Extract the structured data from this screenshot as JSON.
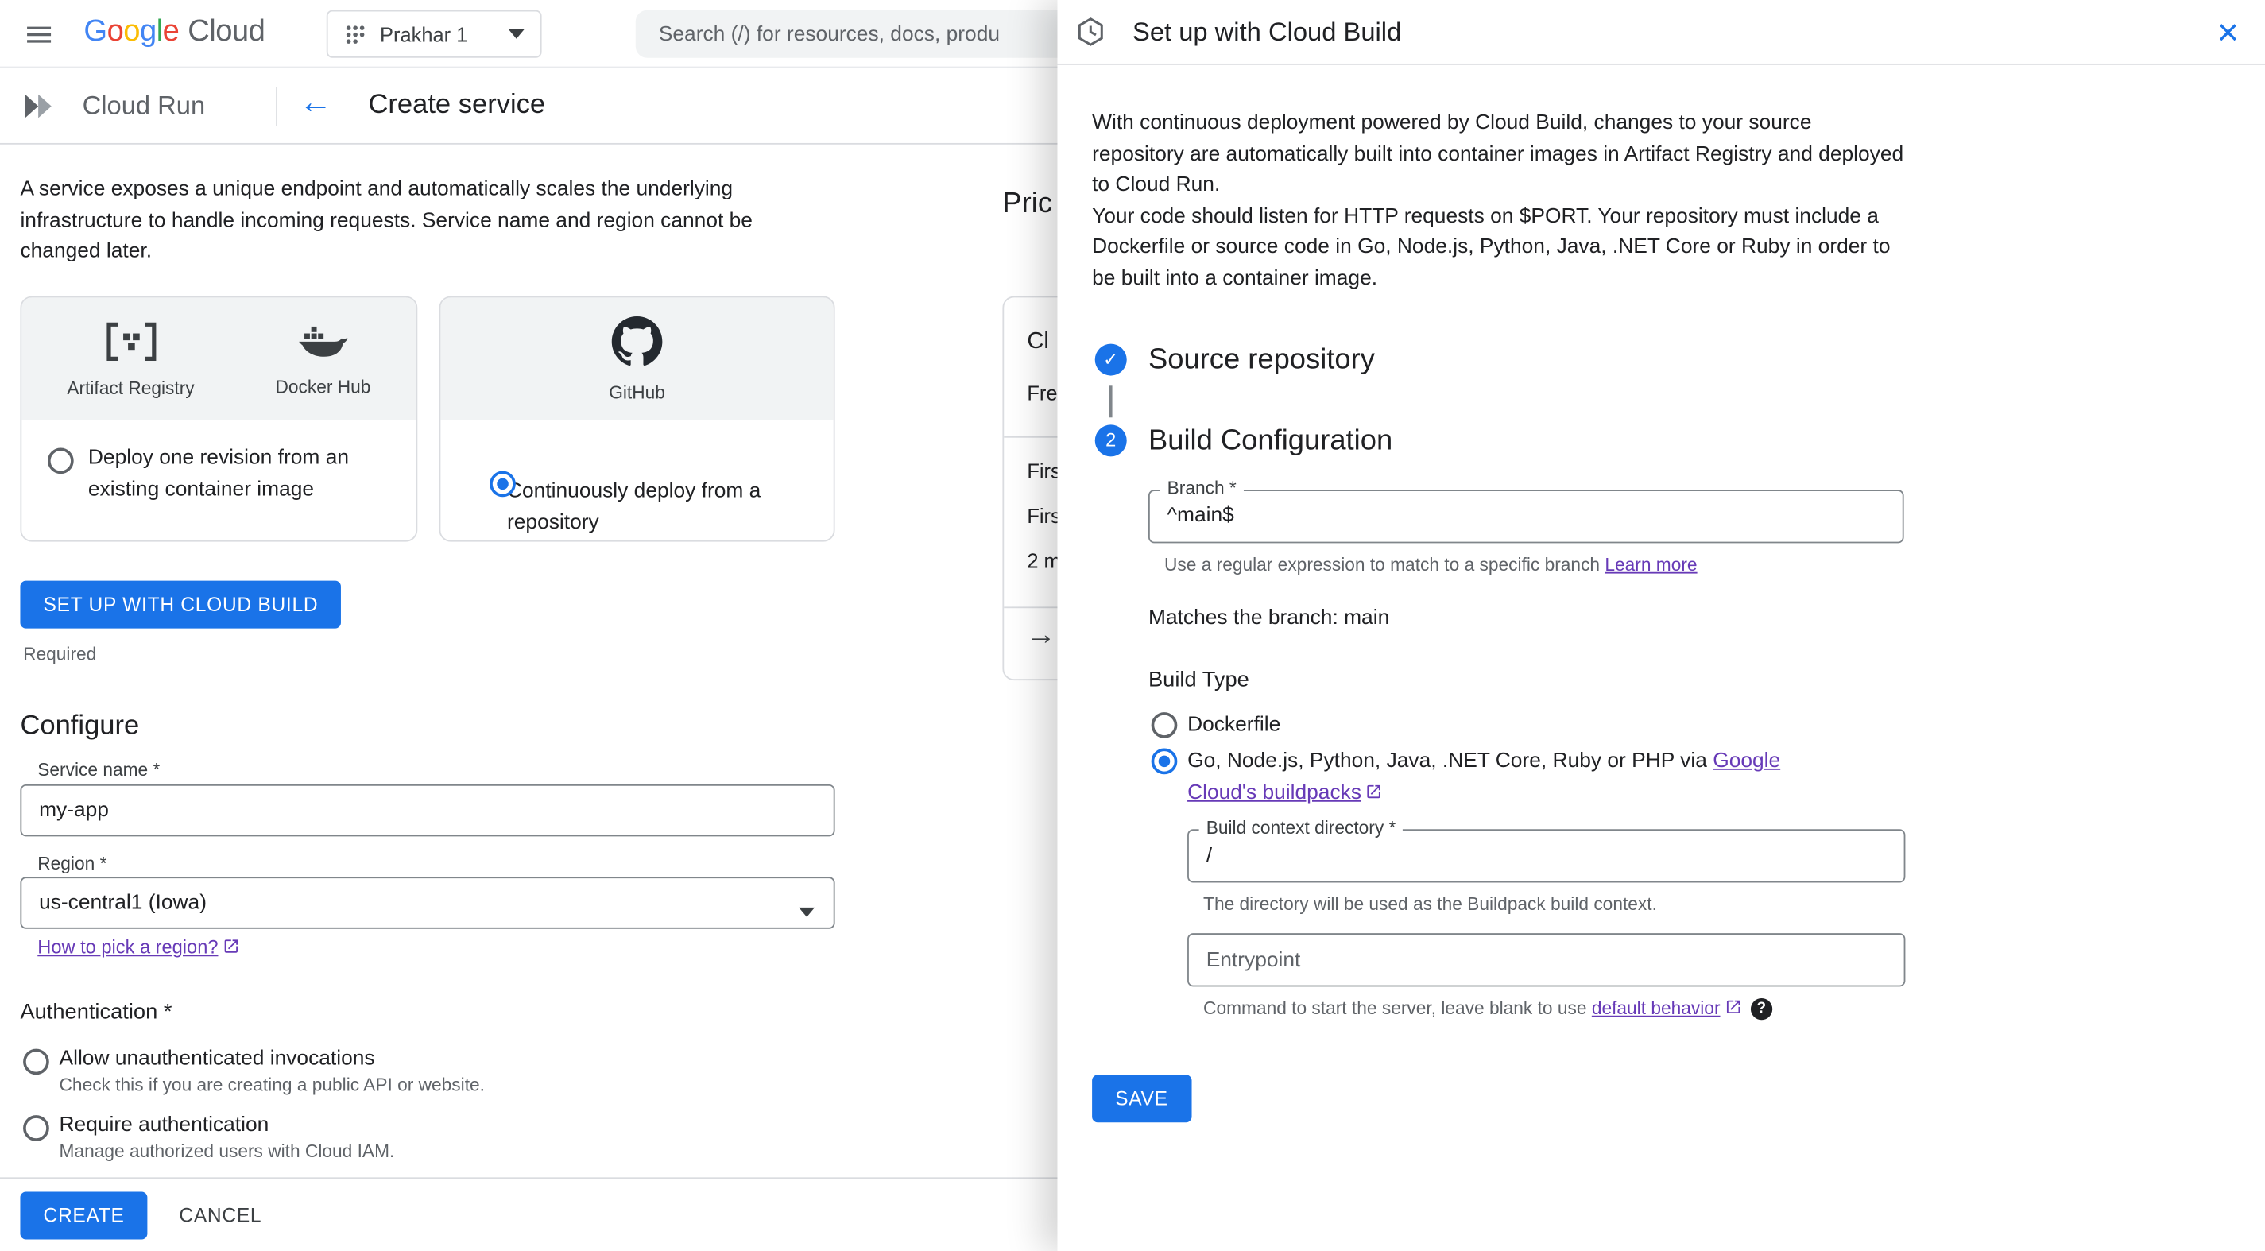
{
  "colors": {
    "accent_blue": "#1a73e8",
    "link_purple": "#673ab7",
    "text_primary": "#202124",
    "text_secondary": "#5f6368",
    "border": "#dadce0",
    "field_border": "#80868b",
    "surface_gray": "#f1f3f4"
  },
  "icons": {
    "back_arrow": "←",
    "forward_arrow": "→",
    "check": "✓",
    "close": "×",
    "help": "?"
  },
  "topbar": {
    "logo_letters": [
      {
        "ch": "G",
        "color": "#4285F4"
      },
      {
        "ch": "o",
        "color": "#EA4335"
      },
      {
        "ch": "o",
        "color": "#FBBC04"
      },
      {
        "ch": "g",
        "color": "#4285F4"
      },
      {
        "ch": "l",
        "color": "#34A853"
      },
      {
        "ch": "e",
        "color": "#EA4335"
      }
    ],
    "logo_cloud": "Cloud",
    "project_selector": "Prakhar 1",
    "search_placeholder": "Search (/) for resources, docs, produ"
  },
  "page_header": {
    "product": "Cloud Run",
    "title": "Create service"
  },
  "create_service": {
    "description": "A service exposes a unique endpoint and automatically scales the underlying infrastructure to handle incoming requests. Service name and region cannot be changed later.",
    "cards": [
      {
        "icons": [
          {
            "name": "artifact-registry",
            "label": "Artifact Registry"
          },
          {
            "name": "docker-hub",
            "label": "Docker Hub"
          }
        ],
        "option": "Deploy one revision from an existing container image",
        "selected": false
      },
      {
        "icons": [
          {
            "name": "github",
            "label": "GitHub"
          }
        ],
        "option": "Continuously deploy from a repository",
        "selected": true
      }
    ],
    "setup_button": "SET UP WITH CLOUD BUILD",
    "required_label": "Required",
    "configure_heading": "Configure",
    "service_name": {
      "label": "Service name *",
      "value": "my-app"
    },
    "region": {
      "label": "Region *",
      "value": "us-central1 (Iowa)",
      "link": "How to pick a region?"
    },
    "authentication": {
      "heading": "Authentication *",
      "options": [
        {
          "label": "Allow unauthenticated invocations",
          "description": "Check this if you are creating a public API or website."
        },
        {
          "label": "Require authentication",
          "description": "Manage authorized users with Cloud IAM."
        }
      ]
    },
    "footer": {
      "create": "CREATE",
      "cancel": "CANCEL"
    }
  },
  "pricing": {
    "heading_fragment": "Pric",
    "row1_fragment": "Cl",
    "row2_fragment": "Fre",
    "row3_fragment": "Firs",
    "row4_fragment": "Firs",
    "row5_fragment": "2 m"
  },
  "panel": {
    "title": "Set up with Cloud Build",
    "intro_1": "With continuous deployment powered by Cloud Build, changes to your source repository are automatically built into container images in Artifact Registry and deployed to Cloud Run.",
    "intro_2": "Your code should listen for HTTP requests on $PORT. Your repository must include a Dockerfile or source code in Go, Node.js, Python, Java, .NET Core or Ruby in order to be built into a container image.",
    "step1_title": "Source repository",
    "step2_number": "2",
    "step2_title": "Build Configuration",
    "branch": {
      "label": "Branch *",
      "value": "^main$",
      "helper": "Use a regular expression to match to a specific branch ",
      "helper_link": "Learn more"
    },
    "matches_text": "Matches the branch: main",
    "build_type_label": "Build Type",
    "build_type_options": [
      {
        "label": "Dockerfile"
      },
      {
        "label_prefix": "Go, Node.js, Python, Java, .NET Core, Ruby or PHP via ",
        "link": "Google Cloud's buildpacks"
      }
    ],
    "build_context": {
      "label": "Build context directory *",
      "value": "/",
      "helper": "The directory will be used as the Buildpack build context."
    },
    "entrypoint": {
      "label": "Entrypoint",
      "helper": "Command to start the server, leave blank to use ",
      "helper_link": "default behavior"
    },
    "save_button": "SAVE"
  }
}
